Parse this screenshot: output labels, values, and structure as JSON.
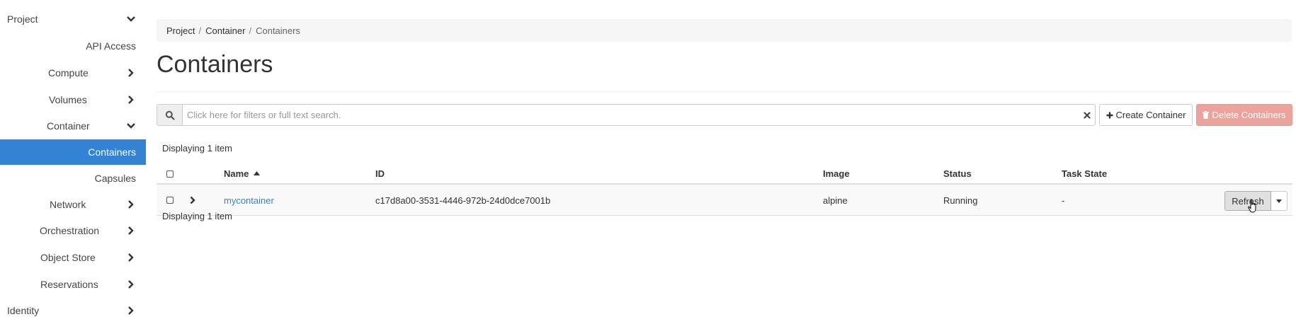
{
  "sidebar": {
    "project_label": "Project",
    "api_access_label": "API Access",
    "compute_label": "Compute",
    "volumes_label": "Volumes",
    "container_label": "Container",
    "containers_label": "Containers",
    "capsules_label": "Capsules",
    "network_label": "Network",
    "orchestration_label": "Orchestration",
    "object_store_label": "Object Store",
    "reservations_label": "Reservations",
    "identity_label": "Identity",
    "active_color": "#3383d5"
  },
  "breadcrumb": {
    "items": [
      "Project",
      "Container",
      "Containers"
    ],
    "separator": "/"
  },
  "page": {
    "title": "Containers"
  },
  "toolbar": {
    "search_placeholder": "Click here for filters or full text search.",
    "create_label": "Create Container",
    "delete_label": "Delete Containers"
  },
  "table": {
    "summary_top": "Displaying 1 item",
    "summary_bottom": "Displaying 1 item",
    "columns": {
      "name": "Name",
      "id": "ID",
      "image": "Image",
      "status": "Status",
      "task_state": "Task State"
    },
    "rows": [
      {
        "name": "mycontainer",
        "id": "c17d8a00-3531-4446-972b-24d0dce7001b",
        "image": "alpine",
        "status": "Running",
        "task_state": "-",
        "action_label": "Refresh"
      }
    ],
    "sort_column": "Name",
    "sort_direction": "ascending"
  },
  "icons": {
    "search": "search-icon",
    "clear": "close-icon",
    "create": "plus-icon",
    "delete": "trash-icon",
    "expand": "chevron-right-icon",
    "dropdown": "caret-down-icon",
    "cursor": "hand-pointer-icon"
  }
}
